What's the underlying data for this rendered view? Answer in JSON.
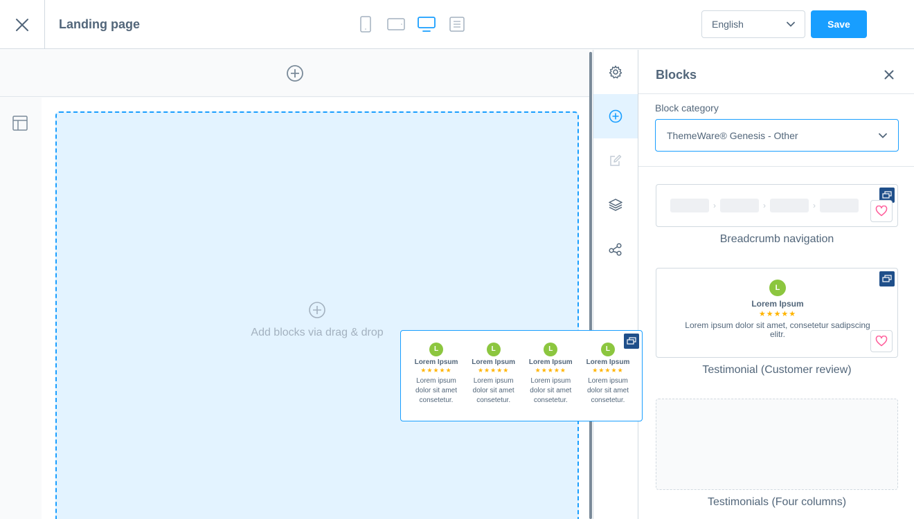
{
  "header": {
    "title": "Landing page",
    "devices": [
      "phone-icon",
      "tablet-icon",
      "desktop-icon",
      "list-view-icon"
    ],
    "active_device": "desktop-icon",
    "language": "English",
    "save_label": "Save"
  },
  "canvas": {
    "dropzone_text": "Add blocks via drag & drop"
  },
  "sidebar_icons": [
    "gear-icon",
    "plus-circle-icon",
    "edit-icon",
    "layers-icon",
    "share-icon"
  ],
  "sidebar_active": "plus-circle-icon",
  "panel": {
    "title": "Blocks",
    "category_label": "Block category",
    "category_value": "ThemeWare® Genesis - Other",
    "blocks": [
      {
        "label": "Breadcrumb navigation"
      },
      {
        "label": "Testimonial (Customer review)",
        "name": "Lorem Ipsum",
        "avatar": "L",
        "stars": "★★★★★",
        "text": "Lorem ipsum dolor sit amet, consetetur sadipscing elitr."
      },
      {
        "label": "Testimonials (Four columns)"
      }
    ]
  },
  "drag_preview": {
    "columns": [
      {
        "avatar": "L",
        "name": "Lorem Ipsum",
        "stars": "★★★★★",
        "text": "Lorem ipsum dolor sit amet consetetur."
      },
      {
        "avatar": "L",
        "name": "Lorem Ipsum",
        "stars": "★★★★★",
        "text": "Lorem ipsum dolor sit amet consetetur."
      },
      {
        "avatar": "L",
        "name": "Lorem Ipsum",
        "stars": "★★★★★",
        "text": "Lorem ipsum dolor sit amet consetetur."
      },
      {
        "avatar": "L",
        "name": "Lorem Ipsum",
        "stars": "★★★★★",
        "text": "Lorem ipsum dolor sit amet consetetur."
      }
    ]
  },
  "colors": {
    "accent": "#189eff",
    "badge": "#1f4f8a",
    "avatar": "#8cc63f",
    "stars": "#ffb400",
    "dropzone_bg": "#e3f3ff"
  }
}
